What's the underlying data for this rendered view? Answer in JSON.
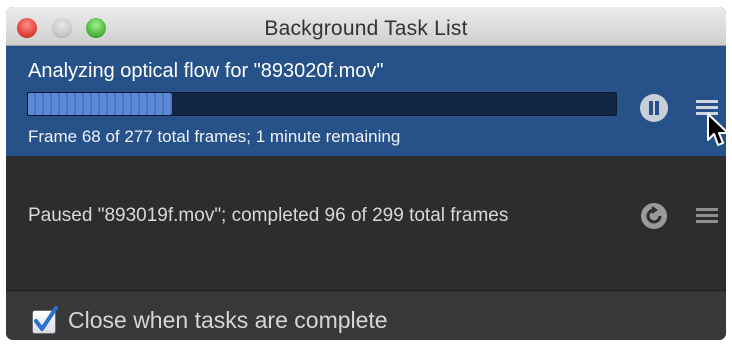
{
  "window": {
    "title": "Background Task List"
  },
  "tasks": [
    {
      "title": "Analyzing optical flow for \"893020f.mov\"",
      "status": "Frame 68 of 277 total frames; 1 minute remaining",
      "progress_fraction": 0.245,
      "control_icon": "pause-icon",
      "menu_icon": "menu-icon",
      "selected": true
    },
    {
      "title": "Paused \"893019f.mov\"; completed 96 of 299 total frames",
      "control_icon": "resume-icon",
      "menu_icon": "menu-icon",
      "selected": false
    }
  ],
  "footer": {
    "close_when_complete_label": "Close when tasks are complete",
    "close_when_complete_checked": true
  },
  "colors": {
    "selected_row": "#265189",
    "window_body": "#2d2d2d",
    "progress_fill": "#5e88d8"
  }
}
